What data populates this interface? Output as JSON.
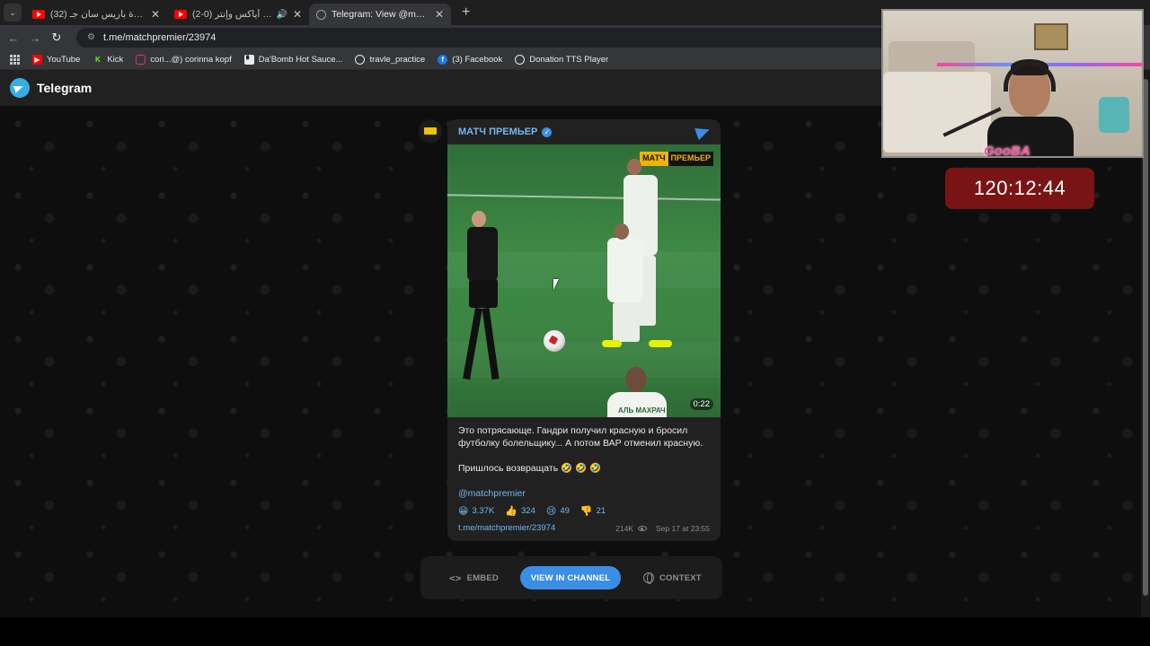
{
  "browser": {
    "tabs": [
      {
        "title": "(32) ملخص مباراة باريس سان جـ",
        "favicon": "youtube-icon",
        "active": false,
        "audio": false
      },
      {
        "title": "ملخص مباراة أياكس وإنتر (0-2) |",
        "favicon": "youtube-icon",
        "active": false,
        "audio": true
      },
      {
        "title": "Telegram: View @matchpremi",
        "favicon": "globe-icon",
        "active": true,
        "audio": false
      }
    ],
    "url": "t.me/matchpremier/23974",
    "bookmarks": [
      {
        "label": "YouTube",
        "icon": "youtube-icon",
        "color": "#ff0000"
      },
      {
        "label": "Kick",
        "icon": "kick-icon",
        "color": "#53fc18"
      },
      {
        "label": "cori...@) corinna kopf",
        "icon": "instagram-icon",
        "color": "#e1306c"
      },
      {
        "label": "Da'Bomb Hot Sauce...",
        "icon": "bookmark-icon",
        "color": "#e8eaed"
      },
      {
        "label": "travle_practice",
        "icon": "compass-icon",
        "color": "#e8eaed"
      },
      {
        "label": "(3) Facebook",
        "icon": "facebook-icon",
        "color": "#1877f2"
      },
      {
        "label": "Donation TTS Player",
        "icon": "globe-icon",
        "color": "#e8eaed"
      }
    ]
  },
  "telegram": {
    "header_title": "Telegram",
    "post": {
      "channel_name": "МАТЧ ПРЕМЬЕР",
      "brand_badge": [
        "МАТЧ",
        "ПРЕМЬЕР"
      ],
      "jersey_text": "АЛЬ МАХРАЧ",
      "video_duration": "0:22",
      "text": "Это потрясающе. Гандри получил красную и бросил футболку болельщику... А потом ВАР отменил красную.\n\nПришлось возвращать 🤣 🤣 🤣",
      "mention": "@matchpremier",
      "reactions": [
        {
          "emoji": "😁",
          "count": "3.37K"
        },
        {
          "emoji": "👍",
          "count": "324"
        },
        {
          "emoji": "😢",
          "count": "49"
        },
        {
          "emoji": "👎",
          "count": "21"
        }
      ],
      "link": "t.me/matchpremier/23974",
      "views": "214K",
      "date": "Sep 17 at 23:55"
    },
    "actions": {
      "embed": "EMBED",
      "view_in_channel": "VIEW IN CHANNEL",
      "context": "CONTEXT"
    },
    "accent_color": "#3a8ee6"
  },
  "stream_overlay": {
    "webcam_logo": "GooBA",
    "timer": "120:12:44",
    "timer_color": "#7a1414"
  }
}
